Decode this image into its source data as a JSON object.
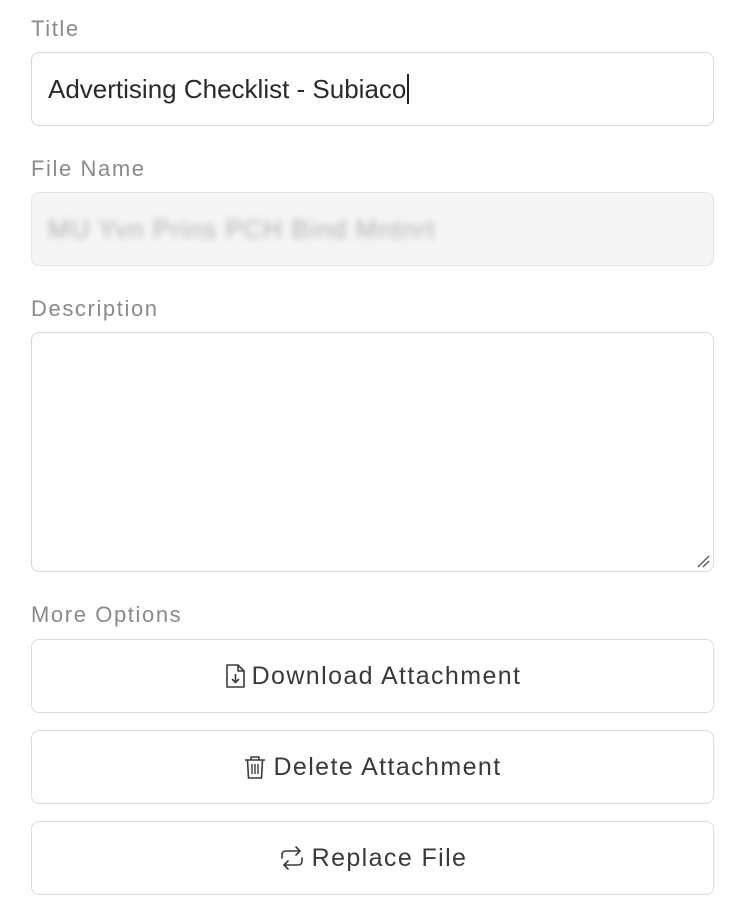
{
  "form": {
    "title_label": "Title",
    "title_value": "Advertising Checklist - Subiaco",
    "filename_label": "File Name",
    "filename_value": "MU Yvn Prins PCH Bind Mntnrt",
    "description_label": "Description",
    "description_value": "",
    "more_options_label": "More Options"
  },
  "actions": {
    "download_label": "Download Attachment",
    "download_icon": "file-download-icon",
    "delete_label": "Delete Attachment",
    "delete_icon": "trash-icon",
    "replace_label": "Replace File",
    "replace_icon": "refresh-icon"
  },
  "colors": {
    "label": "#8a8a8a",
    "border": "#d6d6d6",
    "disabled_bg": "#f5f5f5",
    "text": "#333333"
  }
}
